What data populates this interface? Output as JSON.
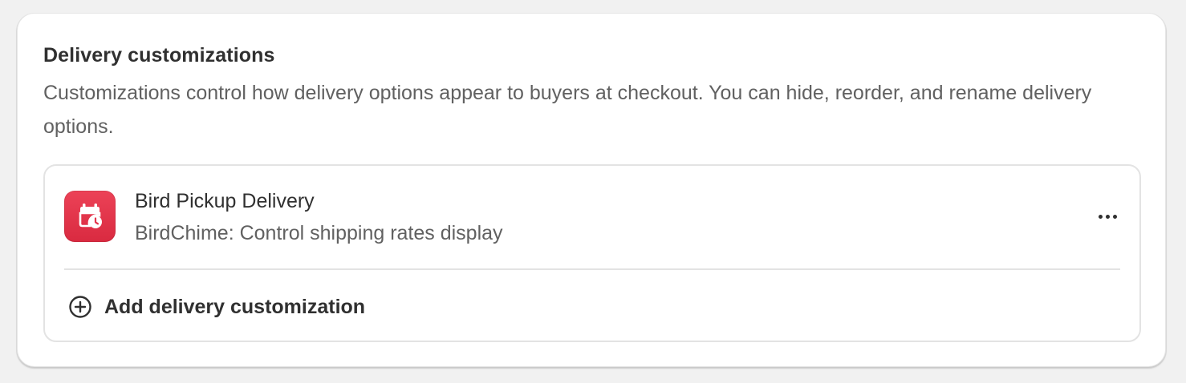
{
  "card": {
    "title": "Delivery customizations",
    "description": "Customizations control how delivery options appear to buyers at checkout. You can hide, reorder, and rename delivery options."
  },
  "customizations": [
    {
      "name": "Bird Pickup Delivery",
      "subtitle": "BirdChime: Control shipping rates display",
      "icon": "calendar-clock-icon",
      "icon_color": "#e3364d"
    }
  ],
  "actions": {
    "more_icon": "more-horizontal-icon",
    "add_label": "Add delivery customization",
    "add_icon": "plus-circle-icon"
  }
}
